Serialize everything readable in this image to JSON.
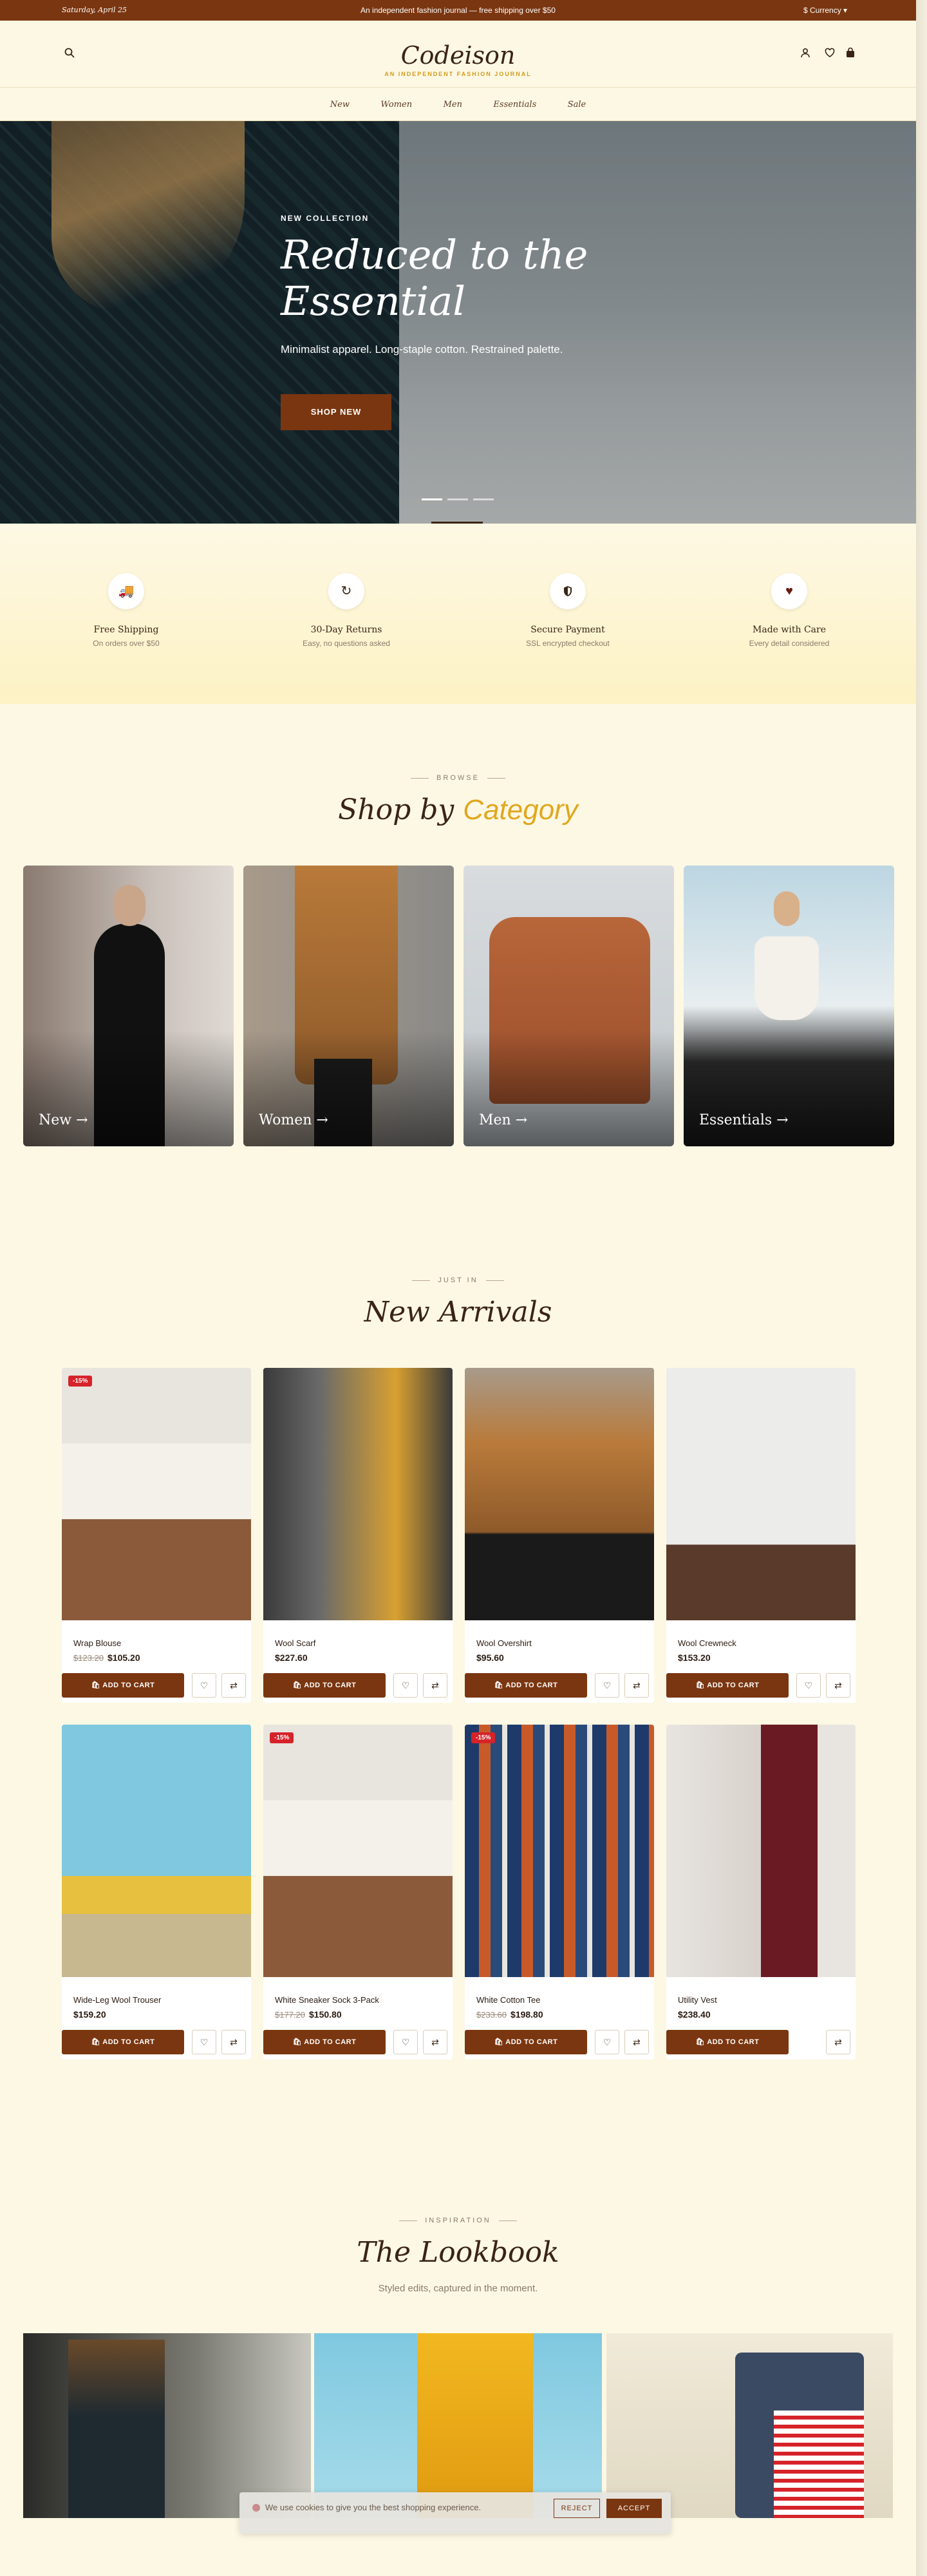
{
  "topbar": {
    "date": "Saturday, April 25",
    "message": "An independent fashion journal — free shipping over $50",
    "currency": "$ Currency ▾"
  },
  "header": {
    "logo": "Codeison",
    "tagline": "AN INDEPENDENT FASHION JOURNAL",
    "icons": [
      "search-icon",
      "user-icon",
      "heart-icon",
      "bag-icon"
    ]
  },
  "nav": {
    "items": [
      "New",
      "Women",
      "Men",
      "Essentials",
      "Sale"
    ]
  },
  "hero": {
    "kicker": "NEW COLLECTION",
    "title_line1": "Reduced to the",
    "title_line2": "Essential",
    "subtitle": "Minimalist apparel. Long-staple cotton. Restrained palette.",
    "button": "SHOP NEW",
    "slides": 3,
    "active_slide": 1
  },
  "features": [
    {
      "icon": "truck-icon",
      "title": "Free Shipping",
      "sub": "On orders over $50"
    },
    {
      "icon": "return-icon",
      "title": "30-Day Returns",
      "sub": "Easy, no questions asked"
    },
    {
      "icon": "shield-icon",
      "title": "Secure Payment",
      "sub": "SSL encrypted checkout"
    },
    {
      "icon": "heart-icon",
      "title": "Made with Care",
      "sub": "Every detail considered"
    }
  ],
  "categories": {
    "kicker": "BROWSE",
    "title_a": "Shop by",
    "title_b": "Category",
    "items": [
      "New →",
      "Women →",
      "Men →",
      "Essentials →"
    ]
  },
  "arrivals": {
    "kicker": "JUST IN",
    "title": "New Arrivals",
    "cta": "ADD TO CART",
    "cart_icon": "bag-icon",
    "products": [
      {
        "name": "Wrap Blouse",
        "old": "$123.20",
        "price": "$105.20",
        "badge": "-15%",
        "wish": true
      },
      {
        "name": "Wool Scarf",
        "old": "",
        "price": "$227.60",
        "badge": "",
        "wish": true
      },
      {
        "name": "Wool Overshirt",
        "old": "",
        "price": "$95.60",
        "badge": "",
        "wish": true
      },
      {
        "name": "Wool Crewneck",
        "old": "",
        "price": "$153.20",
        "badge": "",
        "wish": true
      },
      {
        "name": "Wide-Leg Wool Trouser",
        "old": "",
        "price": "$159.20",
        "badge": "",
        "wish": true
      },
      {
        "name": "White Sneaker Sock 3-Pack",
        "old": "$177.20",
        "price": "$150.80",
        "badge": "-15%",
        "wish": true
      },
      {
        "name": "White Cotton Tee",
        "old": "$233.60",
        "price": "$198.80",
        "badge": "-15%",
        "wish": true
      },
      {
        "name": "Utility Vest",
        "old": "",
        "price": "$238.40",
        "badge": "",
        "wish": false
      }
    ]
  },
  "lookbook": {
    "kicker": "INSPIRATION",
    "title": "The Lookbook",
    "subtitle": "Styled edits, captured in the moment."
  },
  "cookie": {
    "text": "We use cookies to give you the best shopping experience.",
    "reject": "REJECT",
    "accept": "ACCEPT"
  }
}
